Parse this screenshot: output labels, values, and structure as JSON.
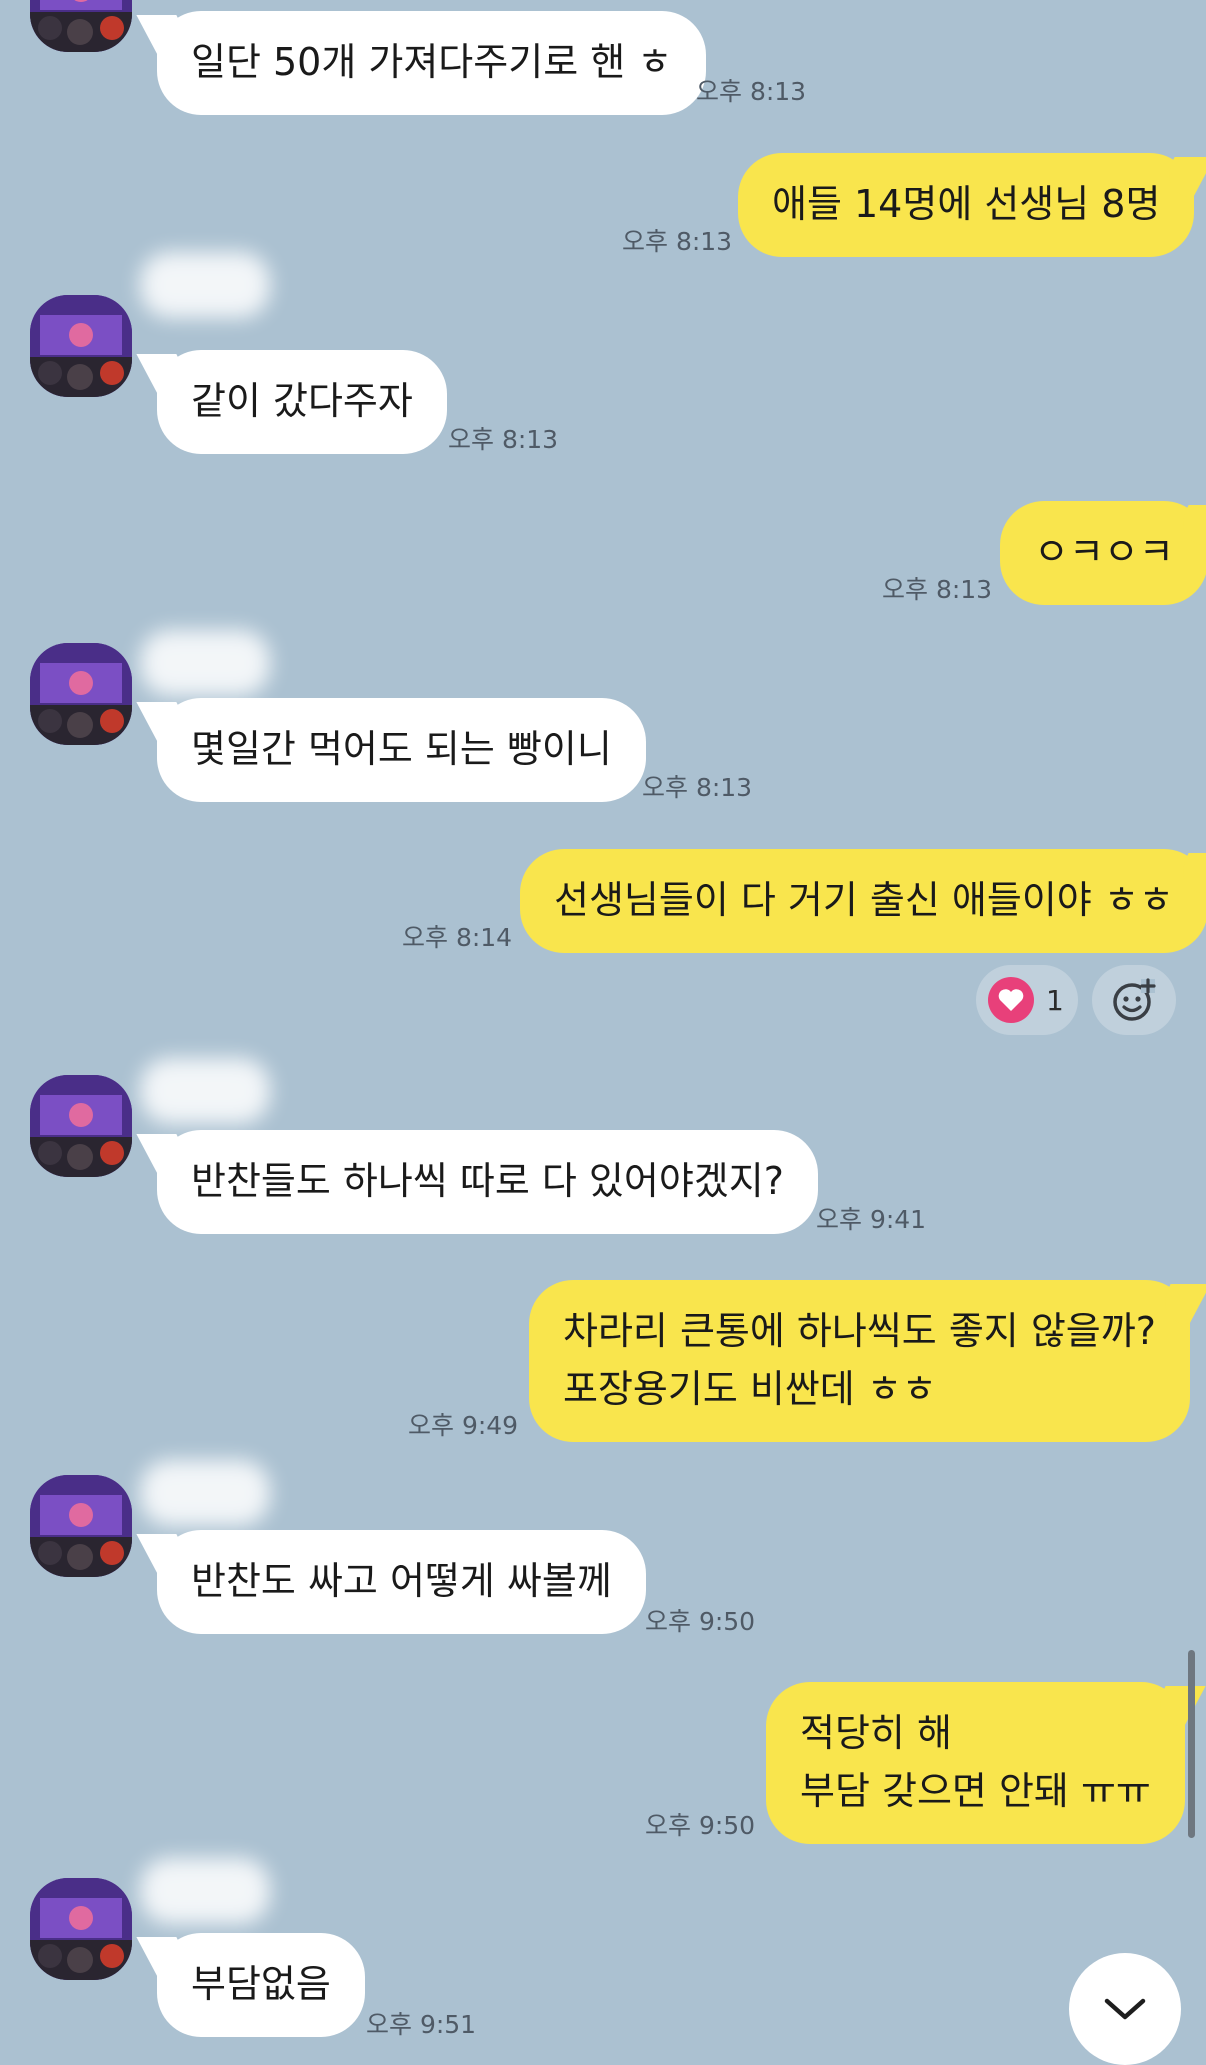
{
  "messages": [
    {
      "side": "in",
      "text_lines": [
        "일단 50개 가져다주기로 핸 ㅎ"
      ],
      "time": "오후 8:13"
    },
    {
      "side": "out",
      "text_lines": [
        "애들 14명에 선생님 8명"
      ],
      "time": "오후 8:13"
    },
    {
      "side": "in",
      "text_lines": [
        "같이 갔다주자"
      ],
      "time": "오후 8:13"
    },
    {
      "side": "out",
      "text_lines": [
        "ㅇㅋㅇㅋ"
      ],
      "time": "오후 8:13"
    },
    {
      "side": "in",
      "text_lines": [
        "몇일간 먹어도 되는 빵이니"
      ],
      "time": "오후 8:13"
    },
    {
      "side": "out",
      "text_lines": [
        "선생님들이 다 거기 출신 애들이야 ㅎㅎ"
      ],
      "time": "오후 8:14",
      "reaction": {
        "icon": "heart-icon",
        "count": "1"
      }
    },
    {
      "side": "in",
      "text_lines": [
        "반찬들도 하나씩 따로 다 있어야겠지?"
      ],
      "time": "오후 9:41"
    },
    {
      "side": "out",
      "text_lines": [
        "차라리 큰통에 하나씩도 좋지 않을까?",
        "포장용기도 비싼데 ㅎㅎ"
      ],
      "time": "오후 9:49"
    },
    {
      "side": "in",
      "text_lines": [
        "반찬도 싸고 어떻게 싸볼께"
      ],
      "time": "오후 9:50"
    },
    {
      "side": "out",
      "text_lines": [
        "적당히 해",
        "부담 갖으면 안돼 ㅠㅠ"
      ],
      "time": "오후 9:50"
    },
    {
      "side": "in",
      "text_lines": [
        "부담없음"
      ],
      "time": "오후 9:51"
    }
  ],
  "colors": {
    "background": "#abc1d1",
    "incoming_bubble": "#ffffff",
    "outgoing_bubble": "#f9e54d",
    "heart": "#e8407a"
  },
  "icons": {
    "add_reaction": "smiley-plus-icon",
    "scroll_down": "chevron-down-icon"
  }
}
